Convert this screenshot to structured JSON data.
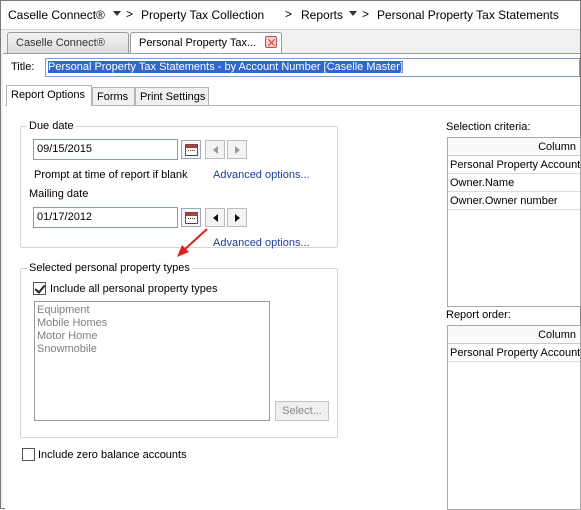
{
  "breadcrumb": {
    "items": [
      "Caselle Connect®",
      "Property Tax Collection",
      "Reports",
      "Personal Property Tax Statements"
    ],
    "separator": ">"
  },
  "doc_tabs": [
    {
      "label": "Caselle Connect®"
    },
    {
      "label": "Personal Property Tax..."
    }
  ],
  "title": {
    "label": "Title:",
    "value": "Personal Property Tax Statements - by Account Number [Caselle Master]"
  },
  "sub_tabs": [
    "Report Options",
    "Forms",
    "Print Settings"
  ],
  "due_date": {
    "group_label": "Due date",
    "value": "09/15/2015",
    "prompt_text": "Prompt at time of report if blank",
    "advanced_link": "Advanced options..."
  },
  "mailing_date": {
    "group_label": "Mailing date",
    "value": "01/17/2012",
    "advanced_link": "Advanced options..."
  },
  "property_types": {
    "group_label": "Selected personal property types",
    "include_all_label": "Include all personal property types",
    "include_all_checked": true,
    "items": [
      "Equipment",
      "Mobile Homes",
      "Motor Home",
      "Snowmobile"
    ],
    "select_button": "Select..."
  },
  "zero_balance": {
    "label": "Include zero balance accounts",
    "checked": false
  },
  "selection_criteria": {
    "label": "Selection criteria:",
    "column_header": "Column",
    "rows": [
      "Personal Property Account...",
      "Owner.Name",
      "Owner.Owner number"
    ]
  },
  "report_order": {
    "label": "Report order:",
    "column_header": "Column",
    "rows": [
      "Personal Property Account..."
    ]
  },
  "colors": {
    "link": "#1a3f9e",
    "selection_highlight": "#3366cc",
    "arrow": "#e02020"
  }
}
